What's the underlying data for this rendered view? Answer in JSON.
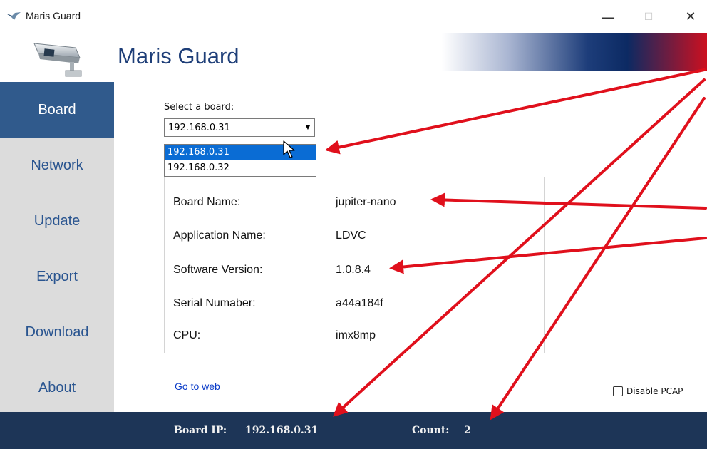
{
  "window": {
    "title": "Maris Guard",
    "minimize_glyph": "—",
    "maximize_glyph": "☐",
    "close_glyph": "✕"
  },
  "header": {
    "app_title": "Maris Guard",
    "logo_icon": "security-camera-icon"
  },
  "sidebar": {
    "items": [
      {
        "label": "Board",
        "active": true
      },
      {
        "label": "Network"
      },
      {
        "label": "Update"
      },
      {
        "label": "Export"
      },
      {
        "label": "Download"
      },
      {
        "label": "About"
      }
    ]
  },
  "board": {
    "select_label": "Select a board:",
    "selected": "192.168.0.31",
    "options": [
      "192.168.0.31",
      "192.168.0.32"
    ],
    "info": [
      {
        "key": "Board Name:",
        "value": "jupiter-nano"
      },
      {
        "key": "Application Name:",
        "value": "LDVC"
      },
      {
        "key": "Software Version:",
        "value": "1.0.8.4"
      },
      {
        "key": "Serial Numaber:",
        "value": "a44a184f"
      },
      {
        "key": "CPU:",
        "value": "imx8mp"
      }
    ],
    "link": "Go to web",
    "disable_pcap_label": "Disable PCAP",
    "disable_pcap_checked": false
  },
  "status": {
    "ip_label": "Board IP:",
    "ip_value": "192.168.0.31",
    "count_label": "Count:",
    "count_value": "2"
  },
  "colors": {
    "accent": "#305a8c",
    "sidebar_bg": "#dcdcdc",
    "statusbar_bg": "#1d3557",
    "title": "#1e3e78",
    "annotation_arrow": "#e0101c"
  }
}
